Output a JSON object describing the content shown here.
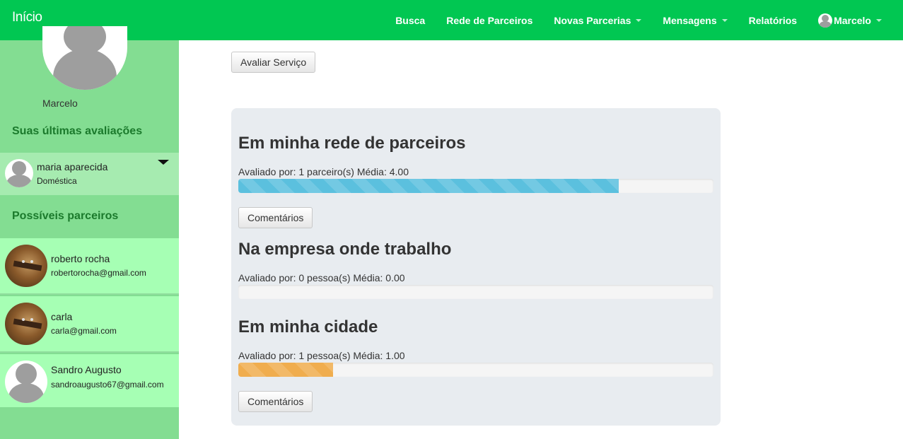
{
  "navbar": {
    "brand": "Início",
    "items": [
      {
        "label": "Busca",
        "dropdown": false
      },
      {
        "label": "Rede de Parceiros",
        "dropdown": false
      },
      {
        "label": "Novas Parcerias",
        "dropdown": true
      },
      {
        "label": "Mensagens",
        "dropdown": true
      },
      {
        "label": "Relatórios",
        "dropdown": false
      }
    ],
    "user": "Marcelo"
  },
  "sidebar": {
    "profile_name": "Marcelo",
    "recent_title": "Suas últimas avaliações",
    "recent": [
      {
        "name": "maria aparecida",
        "role": "Doméstica"
      }
    ],
    "partners_title": "Possíveis parceiros",
    "partners": [
      {
        "name": "roberto rocha",
        "email": "robertorocha@gmail.com",
        "avatar": "guitar-photo"
      },
      {
        "name": "carla",
        "email": "carla@gmail.com",
        "avatar": "guitar-photo"
      },
      {
        "name": "Sandro Augusto",
        "email": "sandroaugusto67@gmail.com",
        "avatar": "default-user"
      }
    ]
  },
  "main": {
    "avaliar_label": "Avaliar Serviço",
    "sections": [
      {
        "title": "Em minha rede de parceiros",
        "meta": "Avaliado por: 1 parceiro(s) Média: 4.00",
        "progress": 0.8,
        "bar_color": "#5bc0de",
        "comments_label": "Comentários"
      },
      {
        "title": "Na empresa onde trabalho",
        "meta": "Avaliado por: 0 pessoa(s) Média: 0.00",
        "progress": 0.0
      },
      {
        "title": "Em minha cidade",
        "meta": "Avaliado por: 1 pessoa(s) Média: 1.00",
        "progress": 0.2,
        "bar_color": "#f0ad4e",
        "comments_label": "Comentários"
      }
    ]
  },
  "colors": {
    "navbar": "#01c752",
    "sidebar": "#83dd92",
    "partner_bg": "#a6ffb4",
    "section_title": "#1b7a2c"
  }
}
